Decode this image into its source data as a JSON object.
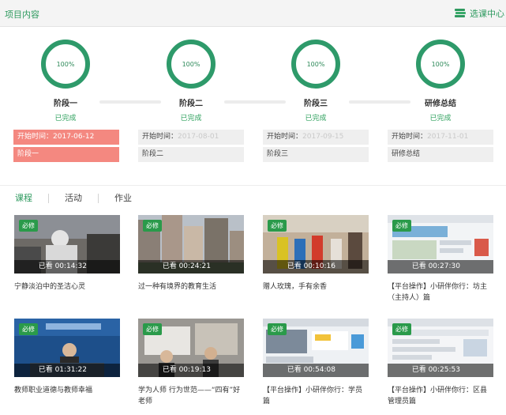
{
  "header": {
    "title": "项目内容",
    "center_label": "选课中心"
  },
  "stages": [
    {
      "percent": "100%",
      "name": "阶段一",
      "status": "已完成",
      "start_label": "开始时间：",
      "start_date": "2017-06-12",
      "stage_label": "阶段一"
    },
    {
      "percent": "100%",
      "name": "阶段二",
      "status": "已完成",
      "start_label": "开始时间：",
      "start_date": "2017-08-01",
      "stage_label": "阶段二"
    },
    {
      "percent": "100%",
      "name": "阶段三",
      "status": "已完成",
      "start_label": "开始时间：",
      "start_date": "2017-09-15",
      "stage_label": "阶段三"
    },
    {
      "percent": "100%",
      "name": "研修总结",
      "status": "已完成",
      "start_label": "开始时间：",
      "start_date": "2017-11-01",
      "stage_label": "研修总结"
    }
  ],
  "tabs": [
    "课程",
    "活动",
    "作业"
  ],
  "courses": [
    {
      "badge": "必修",
      "watched": "已看 00:14:32",
      "title": "宁静淡泊中的圣洁心灵"
    },
    {
      "badge": "必修",
      "watched": "已看 00:24:21",
      "title": "过一种有境界的教育生活"
    },
    {
      "badge": "必修",
      "watched": "已看 00:10:16",
      "title": "赠人玫瑰，手有余香"
    },
    {
      "badge": "必修",
      "watched": "已看 00:27:30",
      "title": "【平台操作】小研伴你行：坊主（主持人）篇"
    },
    {
      "badge": "必修",
      "watched": "已看 01:31:22",
      "title": "教师职业道德与教师幸福"
    },
    {
      "badge": "必修",
      "watched": "已看 00:19:13",
      "title": "学为人师 行为世范——“四有”好老师"
    },
    {
      "badge": "必修",
      "watched": "已看 00:54:08",
      "title": "【平台操作】小研伴你行：学员篇"
    },
    {
      "badge": "必修",
      "watched": "已看 00:25:53",
      "title": "【平台操作】小研伴你行：区县管理员篇"
    }
  ],
  "colors": {
    "accent": "#2e9a5f",
    "ring": "#2e9a6a",
    "active_stage": "#f48880",
    "badge": "#2a9a4a"
  }
}
